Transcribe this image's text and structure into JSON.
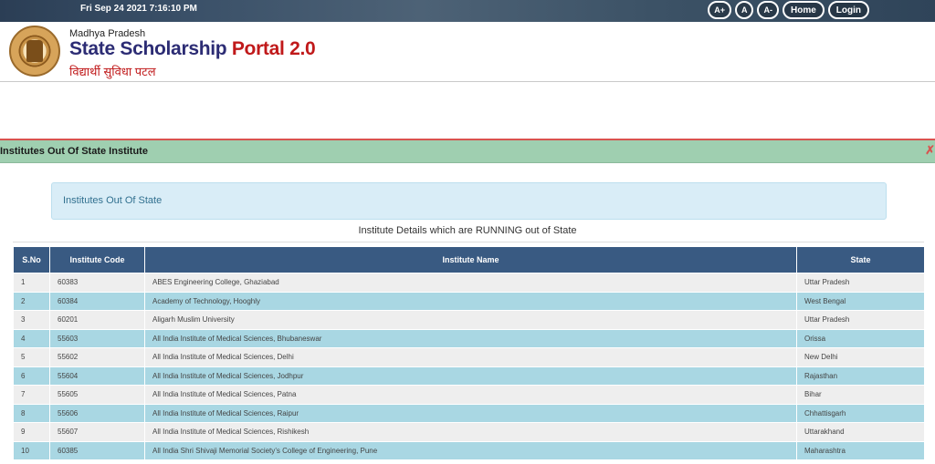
{
  "topbar": {
    "datetime": "Fri Sep 24 2021 7:16:10 PM",
    "font_increase": "A+",
    "font_normal": "A",
    "font_decrease": "A-",
    "home": "Home",
    "login": "Login"
  },
  "brand": {
    "region": "Madhya Pradesh",
    "title_main": "State Scholarship ",
    "title_accent": "Portal 2.0",
    "hindi": "विद्यार्थी सुविधा पटल"
  },
  "section": {
    "title": "Institutes Out Of State Institute",
    "close_icon": "✗"
  },
  "info_box": {
    "text": "Institutes Out Of State"
  },
  "caption": "Institute Details which are RUNNING out of State",
  "table": {
    "headers": [
      "S.No",
      "Institute Code",
      "Institute Name",
      "State"
    ],
    "rows": [
      [
        "1",
        "60383",
        "ABES Engineering College, Ghaziabad",
        "Uttar Pradesh"
      ],
      [
        "2",
        "60384",
        "Academy of Technology, Hooghly",
        "West Bengal"
      ],
      [
        "3",
        "60201",
        "Aligarh Muslim University",
        "Uttar Pradesh"
      ],
      [
        "4",
        "55603",
        "All India Institute of Medical Sciences, Bhubaneswar",
        "Orissa"
      ],
      [
        "5",
        "55602",
        "All India Institute of Medical Sciences, Delhi",
        "New Delhi"
      ],
      [
        "6",
        "55604",
        "All India Institute of Medical Sciences, Jodhpur",
        "Rajasthan"
      ],
      [
        "7",
        "55605",
        "All India Institute of Medical Sciences, Patna",
        "Bihar"
      ],
      [
        "8",
        "55606",
        "All India Institute of Medical Sciences, Raipur",
        "Chhattisgarh"
      ],
      [
        "9",
        "55607",
        "All India Institute of Medical Sciences, Rishikesh",
        "Uttarakhand"
      ],
      [
        "10",
        "60385",
        "All India Shri Shivaji Memorial Society’s College of Engineering, Pune",
        "Maharashtra"
      ]
    ]
  },
  "colors": {
    "table_header": "#395a82",
    "row_odd": "#eeeeee",
    "row_even": "#a9d7e3",
    "section_bar": "#9fcfb0",
    "brand_blue": "#2c2c74",
    "brand_red": "#c0191a"
  }
}
